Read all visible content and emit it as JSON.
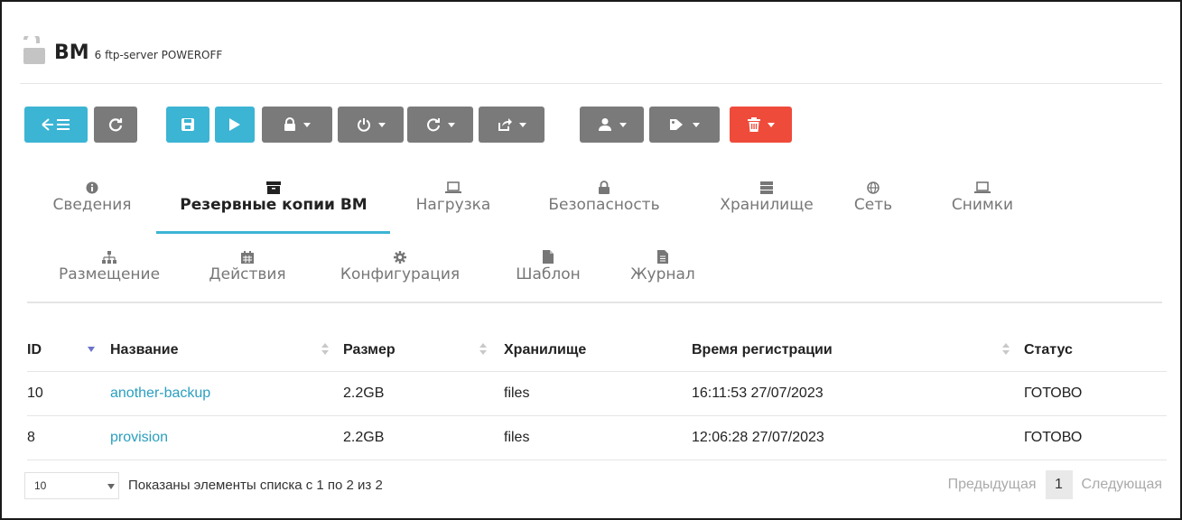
{
  "header": {
    "title": "ВМ",
    "subtitle": "6 ftp-server POWEROFF",
    "icon": "unlock-icon"
  },
  "toolbar": [
    {
      "name": "back-to-list-button",
      "icon": "arrow-list-icon",
      "color": "#3cb4d4",
      "dropdown": false
    },
    {
      "name": "refresh-button",
      "icon": "refresh-icon",
      "color": "#7a7a7a",
      "dropdown": false
    },
    {
      "name": "save-button",
      "icon": "floppy-icon",
      "color": "#3cb4d4",
      "dropdown": false
    },
    {
      "name": "play-button",
      "icon": "play-icon",
      "color": "#3cb4d4",
      "dropdown": false
    },
    {
      "name": "lock-menu-button",
      "icon": "lock-icon",
      "color": "#7a7a7a",
      "dropdown": true
    },
    {
      "name": "power-menu-button",
      "icon": "power-icon",
      "color": "#7a7a7a",
      "dropdown": true
    },
    {
      "name": "reboot-menu-button",
      "icon": "reload-icon",
      "color": "#7a7a7a",
      "dropdown": true
    },
    {
      "name": "share-menu-button",
      "icon": "share-icon",
      "color": "#7a7a7a",
      "dropdown": true
    },
    {
      "name": "user-menu-button",
      "icon": "user-icon",
      "color": "#7a7a7a",
      "dropdown": true
    },
    {
      "name": "tags-menu-button",
      "icon": "tag-icon",
      "color": "#7a7a7a",
      "dropdown": true
    },
    {
      "name": "delete-menu-button",
      "icon": "trash-icon",
      "color": "#ef4b3b",
      "dropdown": true
    }
  ],
  "tabs_row1": [
    {
      "label": "Сведения",
      "icon": "info-icon"
    },
    {
      "label": "Резервные копии ВМ",
      "icon": "archive-icon",
      "active": true
    },
    {
      "label": "Нагрузка",
      "icon": "laptop-icon"
    },
    {
      "label": "Безопасность",
      "icon": "lock-icon"
    },
    {
      "label": "Хранилище",
      "icon": "server-icon"
    },
    {
      "label": "Сеть",
      "icon": "globe-icon"
    },
    {
      "label": "Снимки",
      "icon": "laptop-icon"
    }
  ],
  "tabs_row2": [
    {
      "label": "Размещение",
      "icon": "sitemap-icon"
    },
    {
      "label": "Действия",
      "icon": "calendar-icon"
    },
    {
      "label": "Конфигурация",
      "icon": "gear-icon"
    },
    {
      "label": "Шаблон",
      "icon": "file-icon"
    },
    {
      "label": "Журнал",
      "icon": "file-text-icon"
    }
  ],
  "table": {
    "columns": [
      "ID",
      "Название",
      "Размер",
      "Хранилище",
      "Время регистрации",
      "Статус"
    ],
    "rows": [
      [
        "10",
        "another-backup",
        "2.2GB",
        "files",
        "16:11:53 27/07/2023",
        "ГОТОВО"
      ],
      [
        "8",
        "provision",
        "2.2GB",
        "files",
        "12:06:28 27/07/2023",
        "ГОТОВО"
      ]
    ]
  },
  "footer": {
    "page_size": "10",
    "info": "Показаны элементы списка с 1 по 2 из 2",
    "prev": "Предыдущая",
    "current_page": "1",
    "next": "Следующая"
  }
}
